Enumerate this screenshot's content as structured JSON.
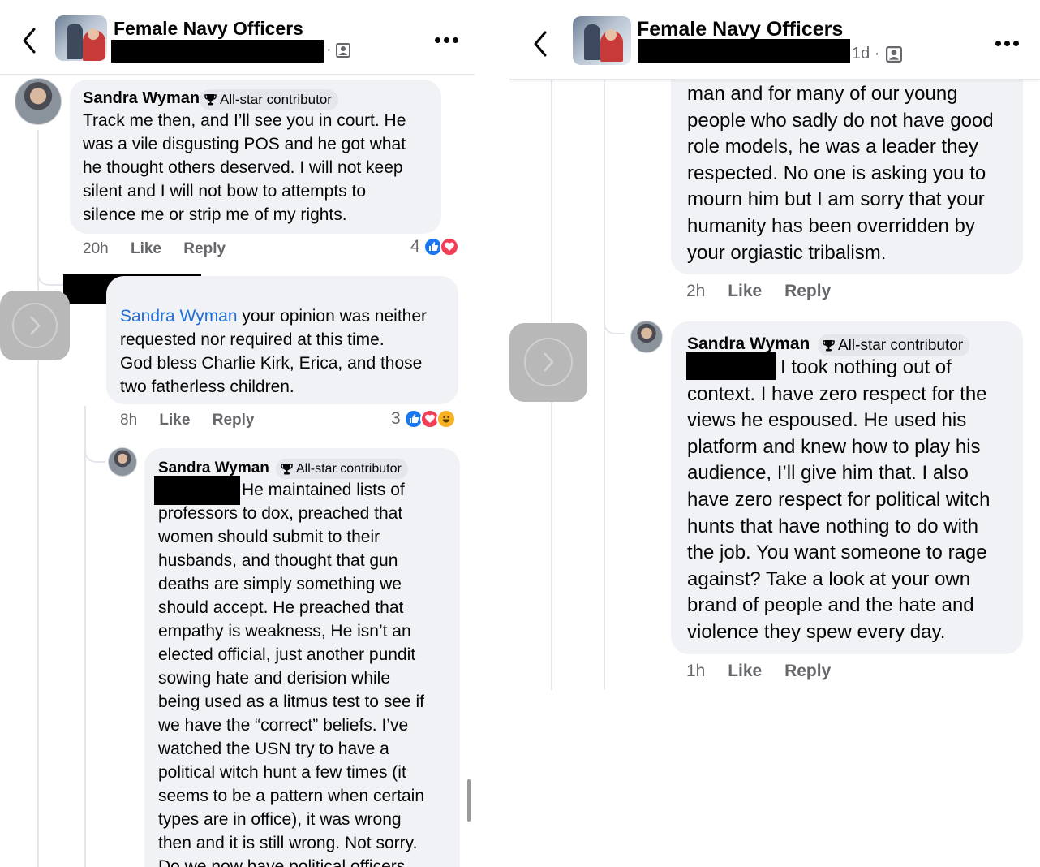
{
  "left_panel": {
    "header": {
      "group_name": "Female Navy Officers",
      "meta_separator": "·",
      "icons": [
        "back-chevron-icon",
        "group-members-icon",
        "more-options-icon"
      ]
    },
    "comments": [
      {
        "author": "Sandra Wyman",
        "badge": "All-star contributor",
        "text": "Track me then, and I’ll see you in court. He\nwas a vile disgusting POS and he got what\nhe thought others deserved. I will not keep\nsilent and I will not bow to attempts to\nsilence me or strip me of my rights.",
        "time": "20h",
        "like": "Like",
        "reply": "Reply",
        "reaction_count": "4",
        "reaction_types": [
          "like",
          "love"
        ]
      },
      {
        "mention": "Sandra Wyman",
        "text": " your opinion was neither\nrequested nor required at this time.\nGod bless Charlie Kirk, Erica, and those\ntwo fatherless children.",
        "time": "8h",
        "like": "Like",
        "reply": "Reply",
        "reaction_count": "3",
        "reaction_types": [
          "like",
          "love",
          "haha"
        ]
      },
      {
        "author": "Sandra Wyman",
        "badge": "All-star contributor",
        "text": "He maintained lists of\nprofessors to dox, preached that\nwomen should submit to their\nhusbands, and thought that gun\ndeaths are simply something we\nshould accept. He preached that\nempathy is weakness, He isn’t an\nelected official, just another pundit\nsowing hate and derision while\nbeing used as a litmus test to see if\nwe have the “correct” beliefs. I’ve\nwatched the USN try to have a\npolitical witch hunt a few times (it\nseems to be a pattern when certain\ntypes are in office), it was wrong\nthen and it is still wrong. Not sorry.\nDo we now have political officers"
      }
    ]
  },
  "right_panel": {
    "header": {
      "group_name": "Female Navy Officers",
      "meta": "1d ·",
      "icons": [
        "back-chevron-icon",
        "group-members-icon",
        "more-options-icon"
      ]
    },
    "comments": [
      {
        "text": "man and for many of our young\npeople who sadly do not have good\nrole models, he was a leader they\nrespected.  No one is asking you to\nmourn him but I am sorry that your\nhumanity has been overridden by\nyour orgiastic tribalism.",
        "time": "2h",
        "like": "Like",
        "reply": "Reply"
      },
      {
        "author": "Sandra Wyman",
        "badge": "All-star contributor",
        "text": "I took nothing out of\ncontext. I have zero respect for the\nviews he espoused. He used his\nplatform and knew how to play his\naudience, I’ll give him that. I also\nhave zero respect for political witch\nhunts that have nothing to do with\nthe job.  You want someone to rage\nagainst? Take a look at your own\nbrand of people and the hate and\nviolence they spew every day.",
        "time": "1h",
        "like": "Like",
        "reply": "Reply"
      }
    ]
  },
  "colors": {
    "bubble": "#f0f2f5",
    "mention": "#216fdb",
    "secondary_text": "#65676b",
    "like_reaction": "#1877f2",
    "love_reaction": "#f33e58"
  }
}
